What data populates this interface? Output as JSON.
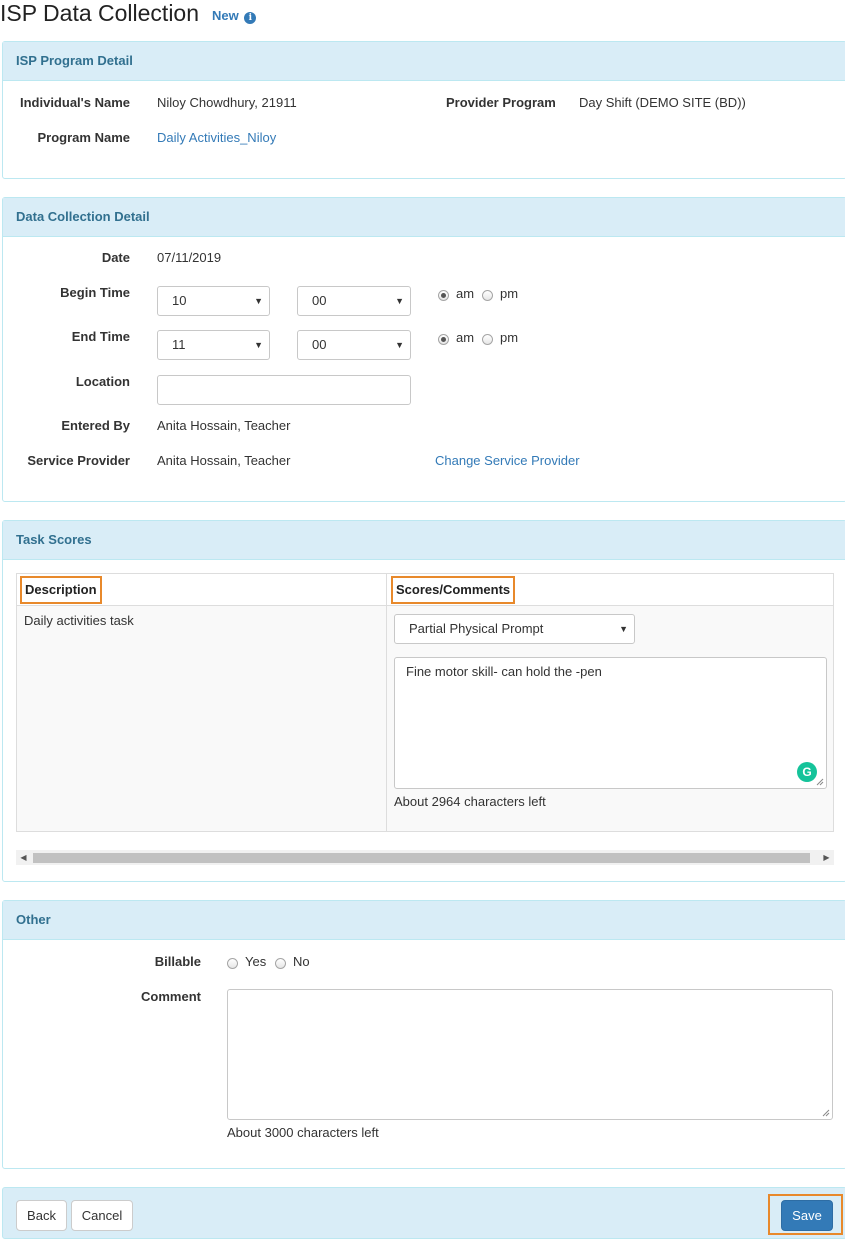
{
  "page": {
    "title": "ISP Data Collection",
    "status": "New"
  },
  "program_detail": {
    "heading": "ISP Program Detail",
    "individual_label": "Individual's Name",
    "individual_value": "Niloy Chowdhury, 21911",
    "provider_program_label": "Provider Program",
    "provider_program_value": "Day Shift (DEMO SITE (BD))",
    "program_name_label": "Program Name",
    "program_name_value": "Daily Activities_Niloy"
  },
  "data_collection": {
    "heading": "Data Collection Detail",
    "date_label": "Date",
    "date_value": "07/11/2019",
    "begin_time_label": "Begin Time",
    "begin_hour": "10",
    "begin_minute": "00",
    "begin_ampm": "am",
    "end_time_label": "End Time",
    "end_hour": "11",
    "end_minute": "00",
    "end_ampm": "am",
    "am_label": "am",
    "pm_label": "pm",
    "location_label": "Location",
    "location_value": "",
    "entered_by_label": "Entered By",
    "entered_by_value": "Anita Hossain, Teacher",
    "service_provider_label": "Service Provider",
    "service_provider_value": "Anita Hossain, Teacher",
    "change_provider_link": "Change Service Provider"
  },
  "task_scores": {
    "heading": "Task Scores",
    "columns": [
      "Description",
      "Scores/Comments"
    ],
    "rows": [
      {
        "description": "Daily activities task",
        "score": "Partial Physical Prompt",
        "comment": "Fine motor skill- can hold the -pen",
        "chars_left": "About 2964 characters left"
      }
    ]
  },
  "other": {
    "heading": "Other",
    "billable_label": "Billable",
    "yes_label": "Yes",
    "no_label": "No",
    "comment_label": "Comment",
    "comment_value": "",
    "chars_left": "About 3000 characters left"
  },
  "footer": {
    "back": "Back",
    "cancel": "Cancel",
    "save": "Save"
  },
  "colors": {
    "panel_heading_bg": "#d9edf7",
    "panel_heading_text": "#31708f",
    "link": "#337ab7",
    "primary": "#337ab7",
    "highlight": "#e8892b"
  },
  "icons": {
    "info": "info-icon",
    "grammarly": "grammarly-icon",
    "caret": "caret-down-icon"
  }
}
